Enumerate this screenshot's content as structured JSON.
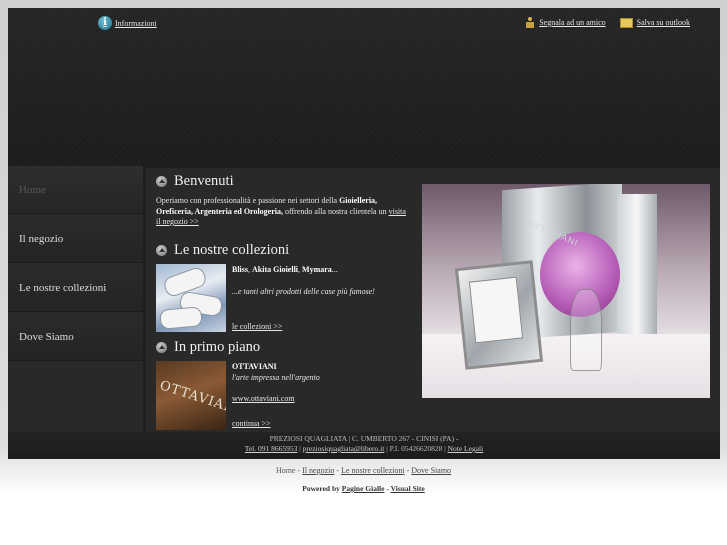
{
  "topbar": {
    "info_label": "Informazioni",
    "info_icon": "info-icon",
    "suggest_label": "Segnala ad un amico",
    "outlook_label": "Salva su outlook"
  },
  "nav": {
    "items": [
      {
        "label": "Home",
        "active": true
      },
      {
        "label": "Il negozio",
        "active": false
      },
      {
        "label": "Le nostre collezioni",
        "active": false
      },
      {
        "label": "Dove Siamo",
        "active": false
      }
    ]
  },
  "welcome": {
    "title": "Benvenuti",
    "text_1": "Operiamo con professionalità e passione nei settori della ",
    "bold_1": "Gioielleria, Oreficeria, Argenteria ed Orologeria,",
    "text_2": " offrendo alla nostra clientela un ",
    "link": "visita il negozio >>"
  },
  "collections": {
    "title": "Le nostre collezioni",
    "brands_1": "Bliss",
    "brands_sep_1": ", ",
    "brands_2": "Akita Gioielli",
    "brands_sep_2": ", ",
    "brands_3": "Mymara",
    "brands_end": "...",
    "tagline": "...e tanti altri prodotti delle case più famose!",
    "link": "le collezioni >>"
  },
  "featured": {
    "title": "In primo piano",
    "brand": "OTTAVIANI",
    "subtitle": "l'arte impressa nell'argento",
    "url": "www.ottaviani.com",
    "link": "continua >>",
    "thumb_word": "OTTAVIANI"
  },
  "photo": {
    "brand_text": "OTTAVIANI"
  },
  "footer": {
    "line1": "PREZIOSI QUAGLIATA | C. UMBERTO 267 - CINISI (PA) -",
    "phone": "Tel. 091 8665953",
    "sep1": " | ",
    "email": "preziosiquagliata@libero.it",
    "vat": " | P.I. 05426620828 | ",
    "legal": "Note Legali"
  },
  "bottom_nav": {
    "home": "Home",
    "sep": " - ",
    "negozio": "Il negozio",
    "collezioni": "Le nostre collezioni",
    "dove": "Dove Siamo"
  },
  "powered": {
    "prefix": "Powered by ",
    "pagine": "Pagine Gialle",
    "sep": " - ",
    "visual": "Visual Site"
  },
  "colors": {
    "background": "#1f1f1f",
    "panel": "#292929",
    "text": "#e6e6e6",
    "nav_active": "#575757"
  }
}
